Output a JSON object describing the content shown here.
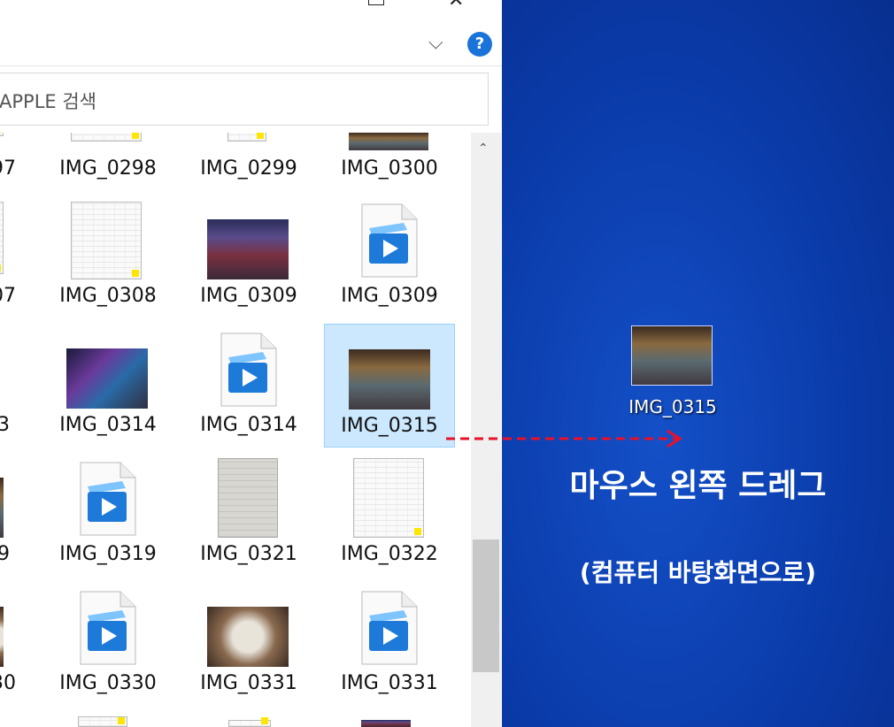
{
  "explorer": {
    "search_placeholder": "APPLE 검색",
    "help_label": "?",
    "close_glyph": "✕",
    "chevron_glyph": "⌵",
    "scroll_up_glyph": "⌃",
    "rows": [
      [
        "97",
        "IMG_0298",
        "IMG_0299",
        "IMG_0300"
      ],
      [
        "07",
        "IMG_0308",
        "IMG_0309",
        "IMG_0309"
      ],
      [
        "3",
        "IMG_0314",
        "IMG_0314",
        "IMG_0315"
      ],
      [
        "9",
        "IMG_0319",
        "IMG_0321",
        "IMG_0322"
      ],
      [
        "30",
        "IMG_0330",
        "IMG_0331",
        "IMG_0331"
      ]
    ],
    "selected_label": "IMG_0315"
  },
  "desktop": {
    "icon_label": "IMG_0315",
    "instruction": "마우스 왼쪽 드레그",
    "sub_instruction": "(컴퓨터 바탕화면으로)",
    "arrow_color": "#e8102a",
    "background_color": "#0a3aa8"
  }
}
